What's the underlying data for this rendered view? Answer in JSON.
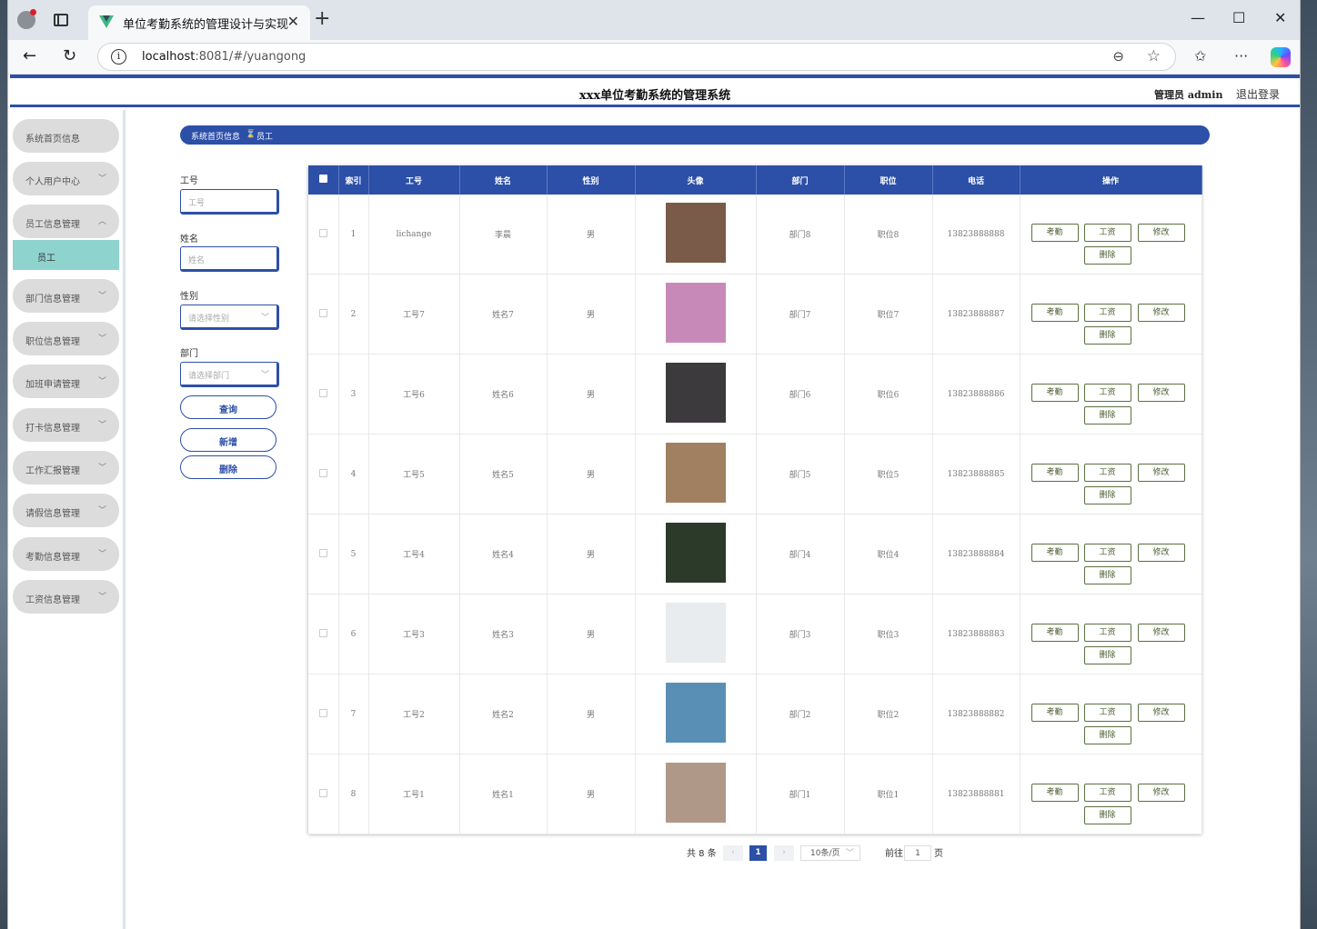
{
  "browser": {
    "tab_title": "单位考勤系统的管理设计与实现",
    "url_host": "localhost",
    "url_path": ":8081/#/yuangong"
  },
  "app": {
    "title": "xxx单位考勤系统的管理系统",
    "user_label": "管理员 admin",
    "logout_label": "退出登录",
    "accent_color": "#2c4fa8"
  },
  "sidebar": {
    "items": [
      {
        "label": "系统首页信息"
      },
      {
        "label": "个人用户中心"
      },
      {
        "label": "员工信息管理"
      },
      {
        "label": "部门信息管理"
      },
      {
        "label": "职位信息管理"
      },
      {
        "label": "加班申请管理"
      },
      {
        "label": "打卡信息管理"
      },
      {
        "label": "工作汇报管理"
      },
      {
        "label": "请假信息管理"
      },
      {
        "label": "考勤信息管理"
      },
      {
        "label": "工资信息管理"
      }
    ],
    "sub_item": "员工"
  },
  "breadcrumb": {
    "home": "系统首页信息",
    "sep": "⌛",
    "current": "员工"
  },
  "filters": {
    "gonghao_label": "工号",
    "gonghao_placeholder": "工号",
    "xingming_label": "姓名",
    "xingming_placeholder": "姓名",
    "xingbie_label": "性别",
    "xingbie_placeholder": "请选择性别",
    "bumen_label": "部门",
    "bumen_placeholder": "请选择部门",
    "query_btn": "查询",
    "add_btn": "新增",
    "delete_btn": "删除"
  },
  "table": {
    "headers": [
      "索引",
      "工号",
      "姓名",
      "性别",
      "头像",
      "部门",
      "职位",
      "电话",
      "操作"
    ],
    "op_labels": {
      "kaoqin": "考勤",
      "gongzi": "工资",
      "xiugai": "修改",
      "shanchu": "删除"
    },
    "rows": [
      {
        "index": "1",
        "gonghao": "lichange",
        "xingming": "李晨",
        "xingbie": "男",
        "bumen": "部门8",
        "zhiwei": "职位8",
        "dianhua": "13823888888",
        "avatar_color": "#7a5a48"
      },
      {
        "index": "2",
        "gonghao": "工号7",
        "xingming": "姓名7",
        "xingbie": "男",
        "bumen": "部门7",
        "zhiwei": "职位7",
        "dianhua": "13823888887",
        "avatar_color": "#c78ab8"
      },
      {
        "index": "3",
        "gonghao": "工号6",
        "xingming": "姓名6",
        "xingbie": "男",
        "bumen": "部门6",
        "zhiwei": "职位6",
        "dianhua": "13823888886",
        "avatar_color": "#3d3a3e"
      },
      {
        "index": "4",
        "gonghao": "工号5",
        "xingming": "姓名5",
        "xingbie": "男",
        "bumen": "部门5",
        "zhiwei": "职位5",
        "dianhua": "13823888885",
        "avatar_color": "#a08060"
      },
      {
        "index": "5",
        "gonghao": "工号4",
        "xingming": "姓名4",
        "xingbie": "男",
        "bumen": "部门4",
        "zhiwei": "职位4",
        "dianhua": "13823888884",
        "avatar_color": "#2c3a2a"
      },
      {
        "index": "6",
        "gonghao": "工号3",
        "xingming": "姓名3",
        "xingbie": "男",
        "bumen": "部门3",
        "zhiwei": "职位3",
        "dianhua": "13823888883",
        "avatar_color": "#e8ecef"
      },
      {
        "index": "7",
        "gonghao": "工号2",
        "xingming": "姓名2",
        "xingbie": "男",
        "bumen": "部门2",
        "zhiwei": "职位2",
        "dianhua": "13823888882",
        "avatar_color": "#5a8fb5"
      },
      {
        "index": "8",
        "gonghao": "工号1",
        "xingming": "姓名1",
        "xingbie": "男",
        "bumen": "部门1",
        "zhiwei": "职位1",
        "dianhua": "13823888881",
        "avatar_color": "#b09888"
      }
    ]
  },
  "pager": {
    "total": "共 8 条",
    "current_page": "1",
    "page_size": "10条/页",
    "goto_label": "前往",
    "goto_value": "1",
    "goto_suffix": "页"
  }
}
